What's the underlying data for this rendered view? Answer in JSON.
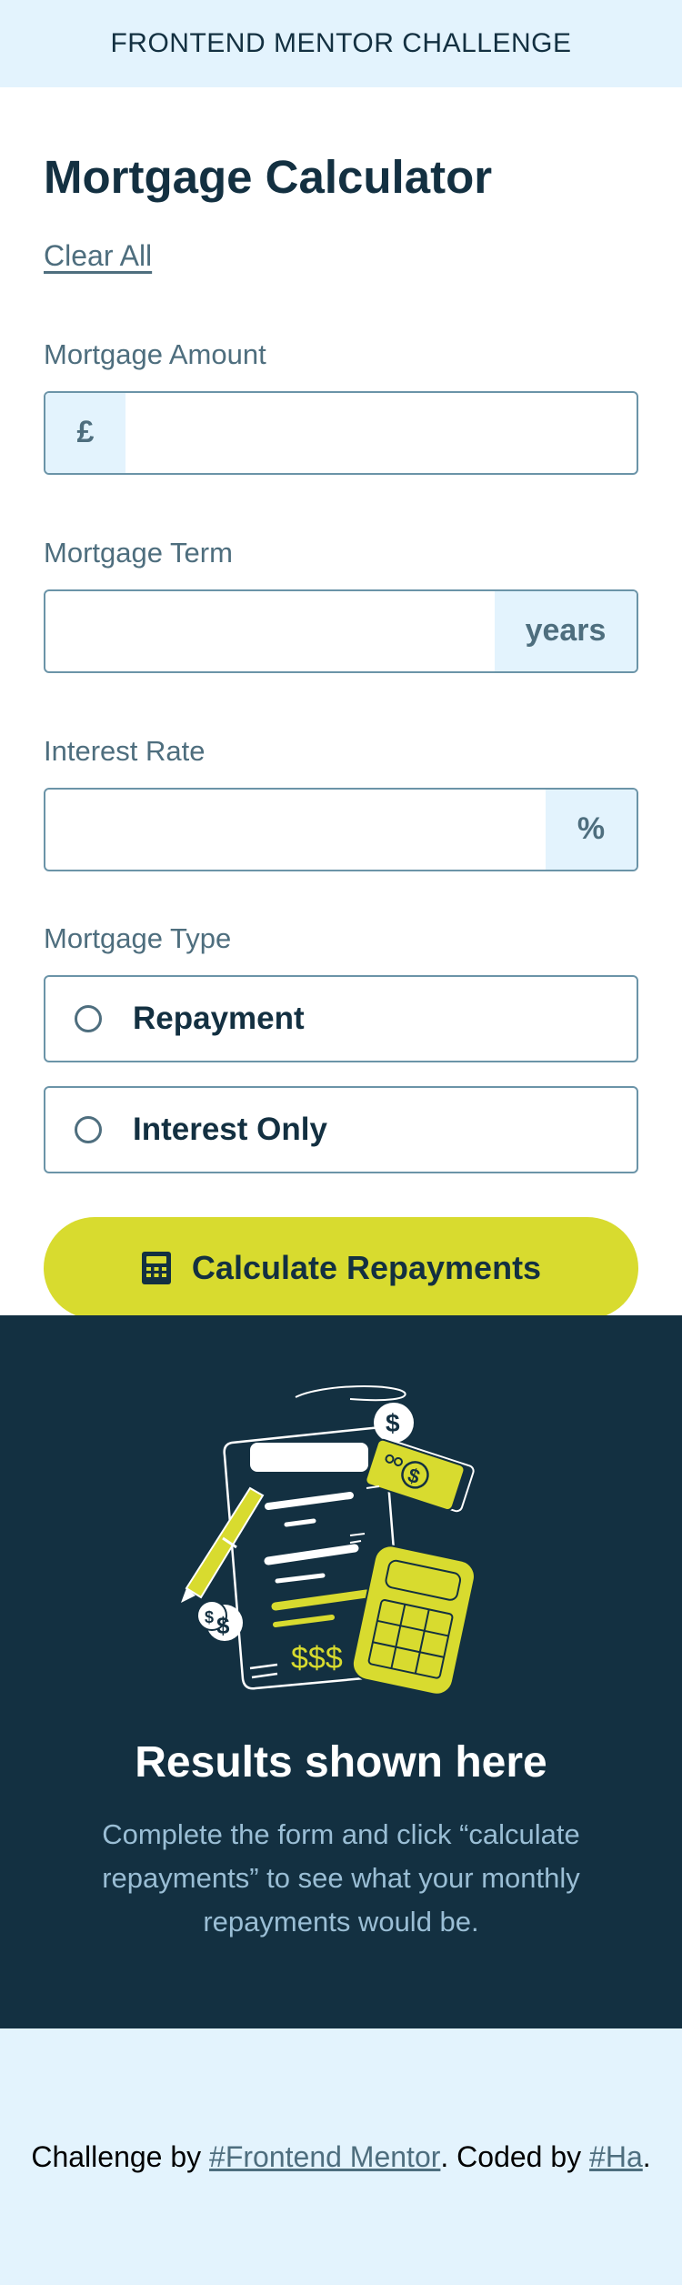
{
  "topbar": {
    "title": "FRONTEND MENTOR CHALLENGE"
  },
  "form": {
    "title": "Mortgage Calculator",
    "clear_all": "Clear All",
    "amount": {
      "label": "Mortgage Amount",
      "prefix": "£",
      "value": ""
    },
    "term": {
      "label": "Mortgage Term",
      "suffix": "years",
      "value": ""
    },
    "rate": {
      "label": "Interest Rate",
      "suffix": "%",
      "value": ""
    },
    "type": {
      "label": "Mortgage Type",
      "options": [
        "Repayment",
        "Interest Only"
      ]
    },
    "submit_label": "Calculate Repayments",
    "submit_icon": "calculator-icon"
  },
  "results": {
    "illustration": "empty-results-illustration",
    "title": "Results shown here",
    "text": "Complete the form and click “calculate repayments” to see what your monthly repayments would be."
  },
  "footer": {
    "prefix": "Challenge by ",
    "link1": "#Frontend Mentor",
    "middle": ". Coded by ",
    "link2": "#Ha",
    "suffix": "."
  },
  "colors": {
    "accent": "#d8db2f",
    "dark": "#133041",
    "light_bg": "#e3f3fd",
    "muted": "#4e6e7e"
  }
}
